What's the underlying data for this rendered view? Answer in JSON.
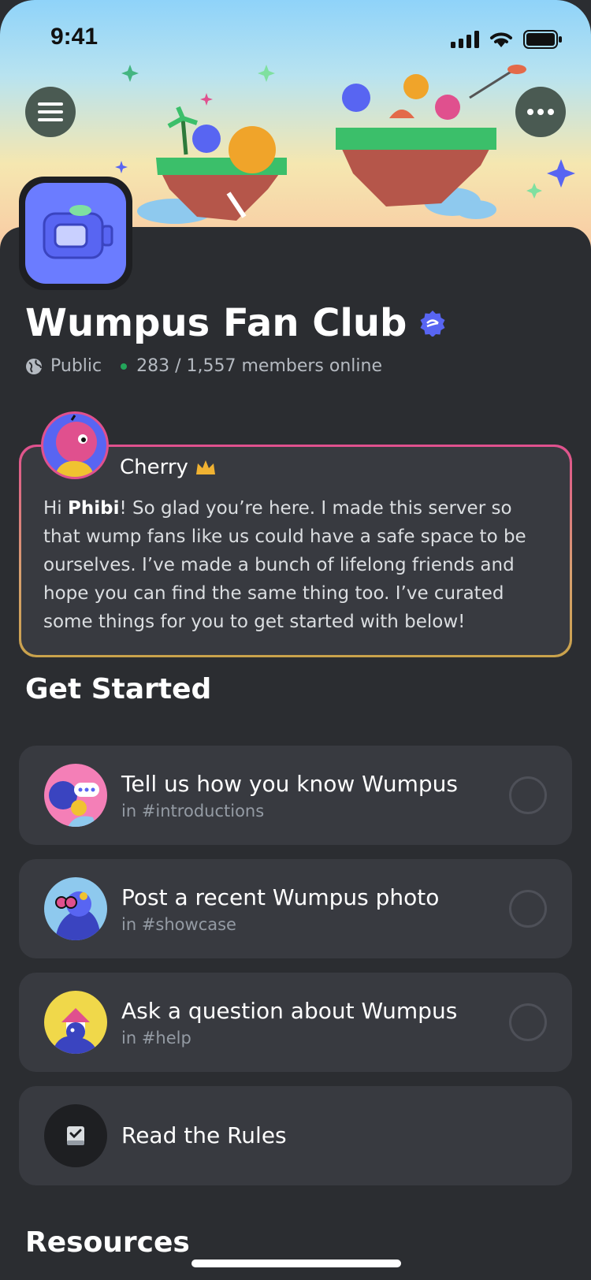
{
  "status": {
    "time": "9:41"
  },
  "server": {
    "name": "Wumpus Fan Club",
    "visibility": "Public",
    "members": "283 / 1,557 members online"
  },
  "welcome": {
    "author": "Cherry",
    "greeting_prefix": "Hi ",
    "greeting_name": "Phibi",
    "message": "! So glad you’re here. I made this server so that wump fans like us could have a safe space to be ourselves. I’ve made a bunch of lifelong friends and hope you can find the same thing too. I’ve curated some things for you to get started with below!"
  },
  "get_started": {
    "title": "Get Started",
    "tasks": [
      {
        "title": "Tell us how you know Wumpus",
        "channel": "in #introductions"
      },
      {
        "title": "Post a recent Wumpus photo",
        "channel": "in #showcase"
      },
      {
        "title": "Ask a question about Wumpus",
        "channel": "in #help"
      },
      {
        "title": "Read the Rules"
      }
    ]
  },
  "resources": {
    "title": "Resources"
  },
  "colors": {
    "background": "#2b2d31",
    "card": "#383a40",
    "online": "#23a55a",
    "verified": "#5865f2",
    "welcome_border_top": "#e0508e",
    "welcome_border_bottom": "#c9a24b"
  }
}
